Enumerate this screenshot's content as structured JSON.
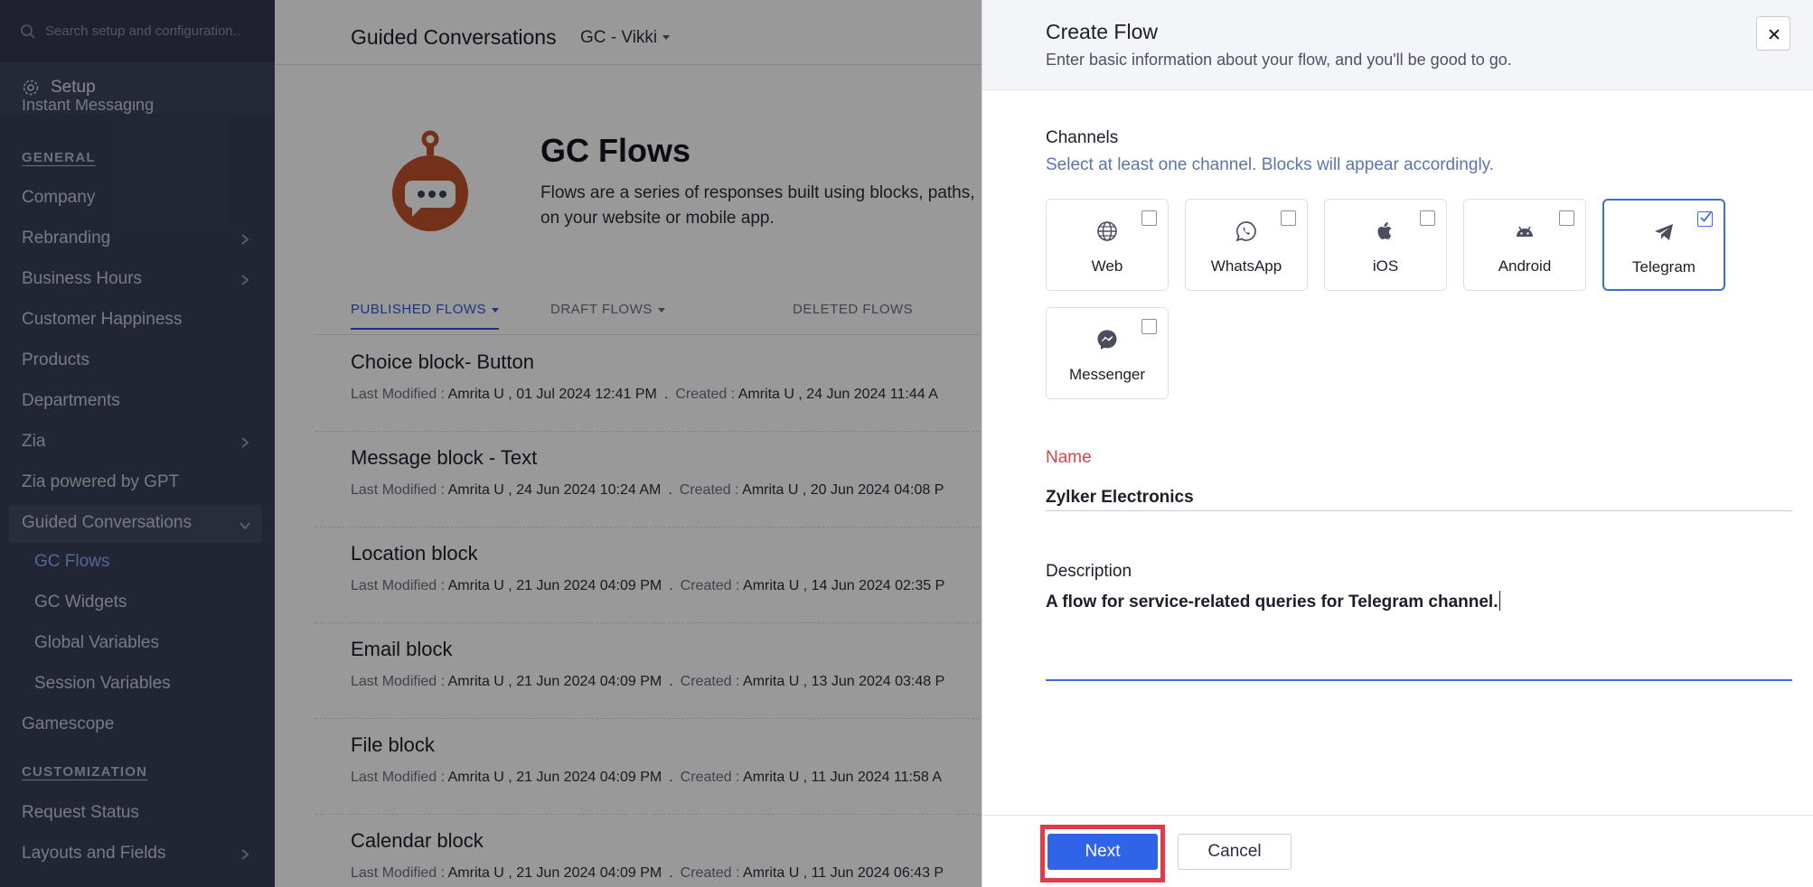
{
  "sidebar": {
    "search_placeholder": "Search setup and configuration..",
    "setup_label": "Setup",
    "clipped_item": "Instant Messaging",
    "section_general": "GENERAL",
    "items": [
      {
        "label": "Company"
      },
      {
        "label": "Rebranding"
      },
      {
        "label": "Business Hours"
      },
      {
        "label": "Customer Happiness"
      },
      {
        "label": "Products"
      },
      {
        "label": "Departments"
      },
      {
        "label": "Zia"
      },
      {
        "label": "Zia powered by GPT"
      },
      {
        "label": "Guided Conversations"
      }
    ],
    "subitems": [
      {
        "label": "GC Flows"
      },
      {
        "label": "GC Widgets"
      },
      {
        "label": "Global Variables"
      },
      {
        "label": "Session Variables"
      }
    ],
    "gamescope": "Gamescope",
    "section_customization": "CUSTOMIZATION",
    "custom_items": [
      {
        "label": "Request Status"
      },
      {
        "label": "Layouts and Fields"
      }
    ]
  },
  "main": {
    "title": "Guided Conversations",
    "portal": "GC - Vikki",
    "hero_title": "GC Flows",
    "hero_desc_1": "Flows are a series of responses built using blocks, paths,",
    "hero_desc_2": "on your website or mobile app.",
    "tabs": [
      {
        "label": "PUBLISHED FLOWS"
      },
      {
        "label": "DRAFT FLOWS"
      },
      {
        "label": "DELETED FLOWS"
      }
    ],
    "meta_last_label": "Last Modified :",
    "meta_created_label": "Created :",
    "meta_dot": ".",
    "flows": [
      {
        "name": "Choice block- Button",
        "modified": "Amrita U , 01 Jul 2024 12:41 PM",
        "created": "Amrita U , 24 Jun 2024 11:44 A"
      },
      {
        "name": "Message block - Text",
        "modified": "Amrita U , 24 Jun 2024 10:24 AM",
        "created": "Amrita U , 20 Jun 2024 04:08 P"
      },
      {
        "name": "Location block",
        "modified": "Amrita U , 21 Jun 2024 04:09 PM",
        "created": "Amrita U , 14 Jun 2024 02:35 P"
      },
      {
        "name": "Email block",
        "modified": "Amrita U , 21 Jun 2024 04:09 PM",
        "created": "Amrita U , 13 Jun 2024 03:48 P"
      },
      {
        "name": "File block",
        "modified": "Amrita U , 21 Jun 2024 04:09 PM",
        "created": "Amrita U , 11 Jun 2024 11:58 A"
      },
      {
        "name": "Calendar block",
        "modified": "Amrita U , 21 Jun 2024 04:09 PM",
        "created": "Amrita U , 11 Jun 2024 06:43 P"
      }
    ]
  },
  "panel": {
    "title": "Create Flow",
    "subtitle": "Enter basic information about your flow, and you'll be good to go.",
    "channels_label": "Channels",
    "channels_hint": "Select at least one channel. Blocks will appear accordingly.",
    "channels": [
      {
        "label": "Web",
        "icon": "globe-icon",
        "checked": false
      },
      {
        "label": "WhatsApp",
        "icon": "whatsapp-icon",
        "checked": false
      },
      {
        "label": "iOS",
        "icon": "apple-icon",
        "checked": false
      },
      {
        "label": "Android",
        "icon": "android-icon",
        "checked": false
      },
      {
        "label": "Telegram",
        "icon": "telegram-icon",
        "checked": true
      },
      {
        "label": "Messenger",
        "icon": "messenger-icon",
        "checked": false
      }
    ],
    "name_label": "Name",
    "name_value": "Zylker Electronics",
    "description_label": "Description",
    "description_value": "A flow for service-related queries for Telegram channel.",
    "next_label": "Next",
    "cancel_label": "Cancel"
  },
  "colors": {
    "sidebar_bg": "#3a3f56",
    "accent": "#2f64e8",
    "required": "#d8424d",
    "highlight": "#e03b48",
    "logo": "#c0532a"
  }
}
